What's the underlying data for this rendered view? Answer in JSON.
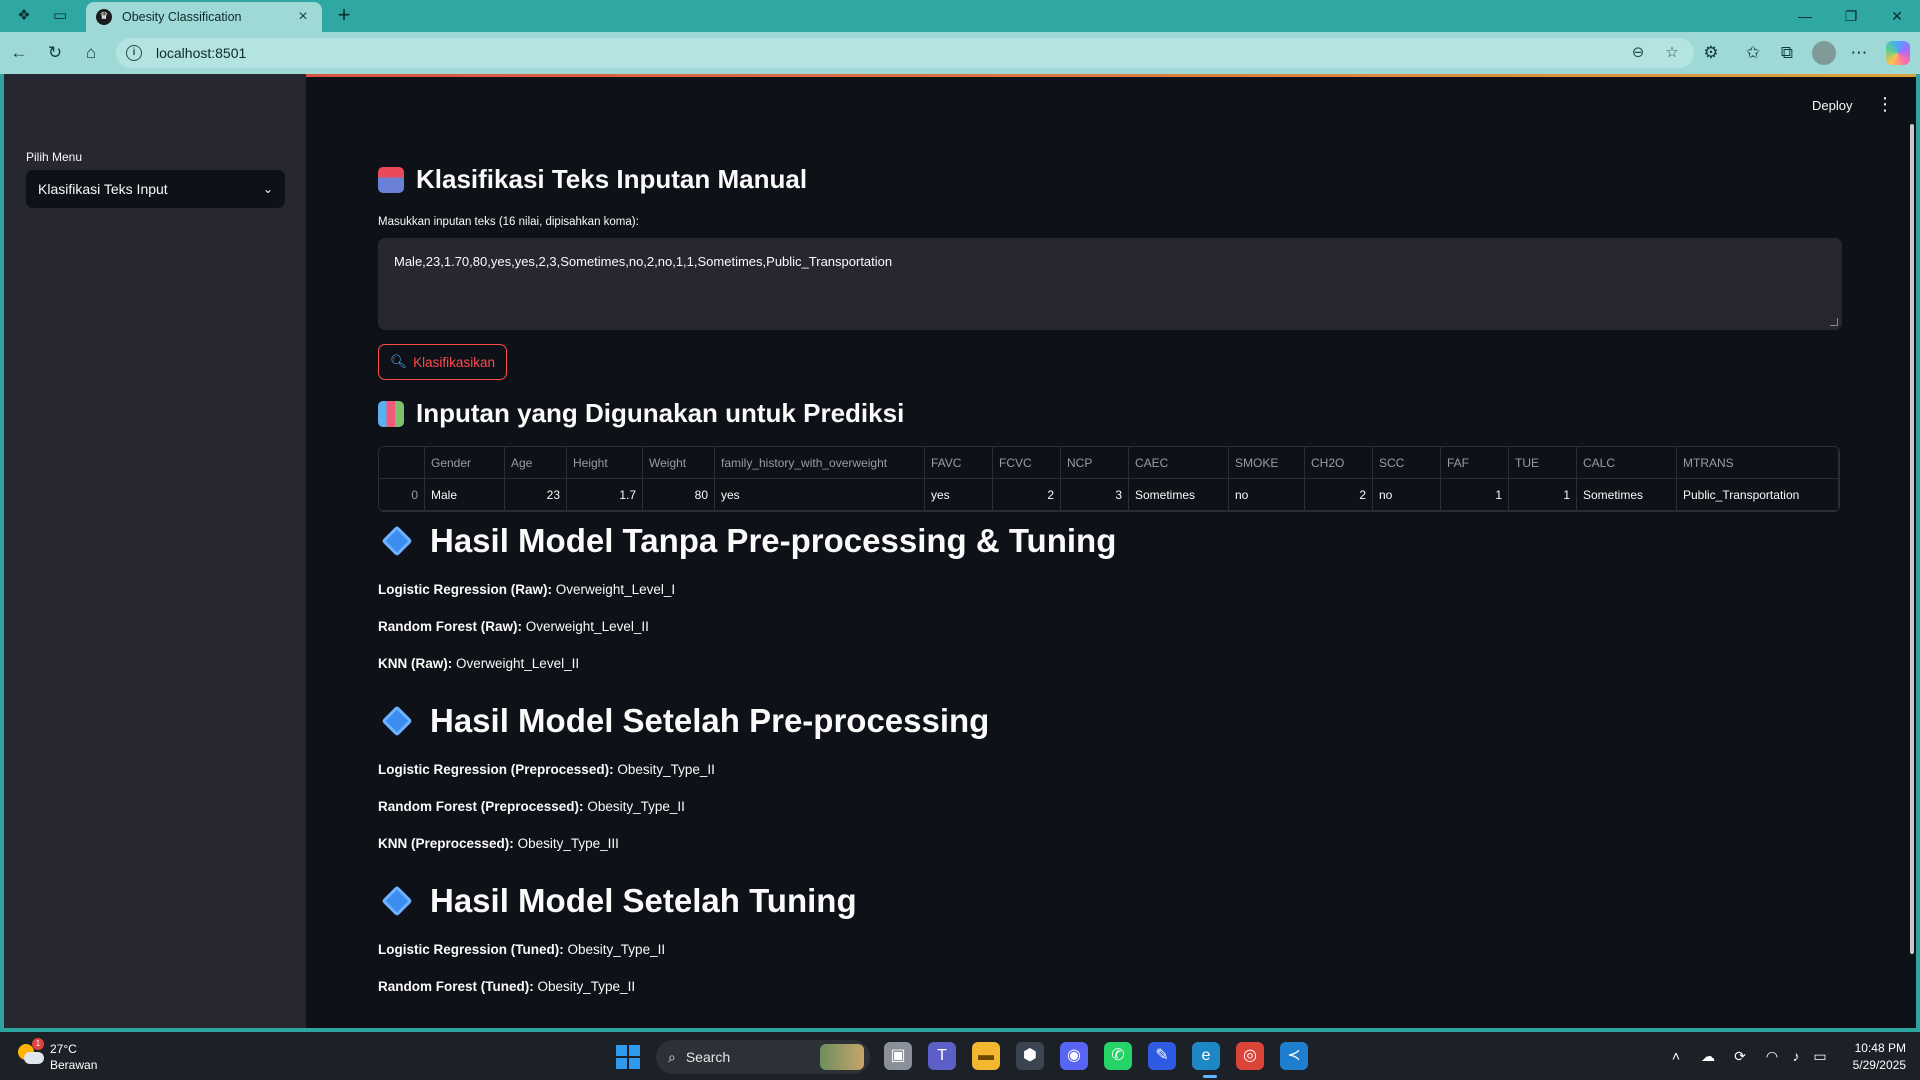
{
  "browser": {
    "tab_title": "Obesity Classification",
    "url": "localhost:8501"
  },
  "sidebar": {
    "label": "Pilih Menu",
    "selected": "Klasifikasi Teks Input"
  },
  "header": {
    "deploy": "Deploy"
  },
  "main": {
    "title": "Klasifikasi Teks Inputan Manual",
    "input_label": "Masukkan inputan teks (16 nilai, dipisahkan koma):",
    "input_value": "Male,23,1.70,80,yes,yes,2,3,Sometimes,no,2,no,1,1,Sometimes,Public_Transportation",
    "button_label": "Klasifikasikan",
    "table_title": "Inputan yang Digunakan untuk Prediksi",
    "table": {
      "columns": [
        "",
        "Gender",
        "Age",
        "Height",
        "Weight",
        "family_history_with_overweight",
        "FAVC",
        "FCVC",
        "NCP",
        "CAEC",
        "SMOKE",
        "CH2O",
        "SCC",
        "FAF",
        "TUE",
        "CALC",
        "MTRANS"
      ],
      "row": [
        "0",
        "Male",
        "23",
        "1.7",
        "80",
        "yes",
        "yes",
        "2",
        "3",
        "Sometimes",
        "no",
        "2",
        "no",
        "1",
        "1",
        "Sometimes",
        "Public_Transportation"
      ]
    },
    "sections": [
      {
        "title": "Hasil Model Tanpa Pre-processing & Tuning",
        "results": [
          {
            "label": "Logistic Regression (Raw):",
            "value": "Overweight_Level_I"
          },
          {
            "label": "Random Forest (Raw):",
            "value": "Overweight_Level_II"
          },
          {
            "label": "KNN (Raw):",
            "value": "Overweight_Level_II"
          }
        ]
      },
      {
        "title": "Hasil Model Setelah Pre-processing",
        "results": [
          {
            "label": "Logistic Regression (Preprocessed):",
            "value": "Obesity_Type_II"
          },
          {
            "label": "Random Forest (Preprocessed):",
            "value": "Obesity_Type_II"
          },
          {
            "label": "KNN (Preprocessed):",
            "value": "Obesity_Type_III"
          }
        ]
      },
      {
        "title": "Hasil Model Setelah Tuning",
        "results": [
          {
            "label": "Logistic Regression (Tuned):",
            "value": "Obesity_Type_II"
          },
          {
            "label": "Random Forest (Tuned):",
            "value": "Obesity_Type_II"
          }
        ]
      }
    ]
  },
  "taskbar": {
    "temp": "27°C",
    "weather": "Berawan",
    "weather_badge": "1",
    "search": "Search",
    "time": "10:48 PM",
    "date": "5/29/2025"
  },
  "colors": {
    "accent": "#ff4b4b",
    "app_bg": "#0e1117",
    "sidebar_bg": "#262730",
    "browser": "#2fa7a3"
  }
}
